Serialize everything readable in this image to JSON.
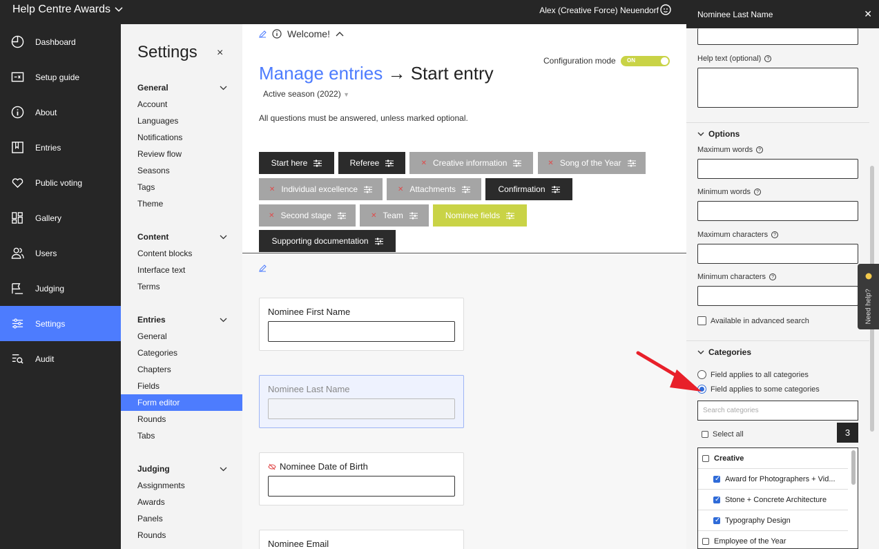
{
  "topbar": {
    "app_title": "Help Centre Awards",
    "user_name": "Alex (Creative Force) Neuendorf"
  },
  "nav": {
    "items": [
      {
        "label": "Dashboard",
        "icon": "dashboard-icon"
      },
      {
        "label": "Setup guide",
        "icon": "setup-guide-icon"
      },
      {
        "label": "About",
        "icon": "info-icon"
      },
      {
        "label": "Entries",
        "icon": "entries-icon"
      },
      {
        "label": "Public voting",
        "icon": "heart-icon"
      },
      {
        "label": "Gallery",
        "icon": "gallery-icon"
      },
      {
        "label": "Users",
        "icon": "users-icon"
      },
      {
        "label": "Judging",
        "icon": "judging-icon"
      },
      {
        "label": "Settings",
        "icon": "settings-icon"
      },
      {
        "label": "Audit",
        "icon": "audit-icon"
      }
    ],
    "active": "Settings"
  },
  "settings": {
    "title": "Settings",
    "close": "×",
    "general": {
      "title": "General",
      "items": [
        "Account",
        "Languages",
        "Notifications",
        "Review flow",
        "Seasons",
        "Tags",
        "Theme"
      ]
    },
    "content": {
      "title": "Content",
      "items": [
        "Content blocks",
        "Interface text",
        "Terms"
      ]
    },
    "entries": {
      "title": "Entries",
      "items": [
        "General",
        "Categories",
        "Chapters",
        "Fields",
        "Form editor",
        "Rounds",
        "Tabs"
      ]
    },
    "judging": {
      "title": "Judging",
      "items": [
        "Assignments",
        "Awards",
        "Panels",
        "Rounds"
      ]
    },
    "active_item": "Form editor"
  },
  "main": {
    "welcome": "Welcome!",
    "config_label": "Configuration mode",
    "config_state": "ON",
    "heading_link": "Manage entries",
    "heading_arrow": "→",
    "heading_rest": "Start entry",
    "season": "Active season (2022)",
    "instructions": "All questions must be answered, unless marked optional.",
    "tabs": [
      {
        "label": "Start here",
        "style": "dark",
        "hidden": false
      },
      {
        "label": "Referee",
        "style": "dark",
        "hidden": false
      },
      {
        "label": "Creative information",
        "style": "grey",
        "hidden": true
      },
      {
        "label": "Song of the Year",
        "style": "grey",
        "hidden": true
      },
      {
        "label": "Individual excellence",
        "style": "grey",
        "hidden": true
      },
      {
        "label": "Attachments",
        "style": "grey",
        "hidden": true
      },
      {
        "label": "Confirmation",
        "style": "dark",
        "hidden": false
      },
      {
        "label": "Second stage",
        "style": "grey",
        "hidden": true
      },
      {
        "label": "Team",
        "style": "grey",
        "hidden": true
      },
      {
        "label": "Nominee fields",
        "style": "lime",
        "hidden": false
      },
      {
        "label": "Supporting documentation",
        "style": "dark",
        "hidden": false
      }
    ],
    "fields": [
      {
        "label": "Nominee First Name",
        "hidden": false,
        "selected": false
      },
      {
        "label": "Nominee Last Name",
        "hidden": false,
        "selected": true
      },
      {
        "label": "Nominee Date of Birth",
        "hidden": true,
        "selected": false
      },
      {
        "label": "Nominee Email",
        "hidden": false,
        "selected": false
      }
    ]
  },
  "drawer": {
    "title": "Nominee Last Name",
    "help_text_label": "Help text (optional)",
    "options_title": "Options",
    "max_words": "Maximum words",
    "min_words": "Minimum words",
    "max_chars": "Maximum characters",
    "min_chars": "Minimum characters",
    "advanced_search": "Available in advanced search",
    "categories_title": "Categories",
    "radio_all": "Field applies to all categories",
    "radio_some": "Field applies to some categories",
    "search_placeholder": "Search categories",
    "select_all": "Select all",
    "selected_count": "3",
    "categories": [
      {
        "label": "Creative",
        "checked": false,
        "bold": true
      },
      {
        "label": "Award for Photographers + Vid...",
        "checked": true,
        "bold": false
      },
      {
        "label": "Stone + Concrete Architecture",
        "checked": true,
        "bold": false
      },
      {
        "label": "Typography Design",
        "checked": true,
        "bold": false
      },
      {
        "label": "Employee of the Year",
        "checked": false,
        "bold": false
      }
    ]
  },
  "need_help": "Need help?",
  "colors": {
    "accent": "#4d7cfe",
    "topbar": "#262626",
    "lime": "#c9d346",
    "arrow": "#e8202a"
  }
}
